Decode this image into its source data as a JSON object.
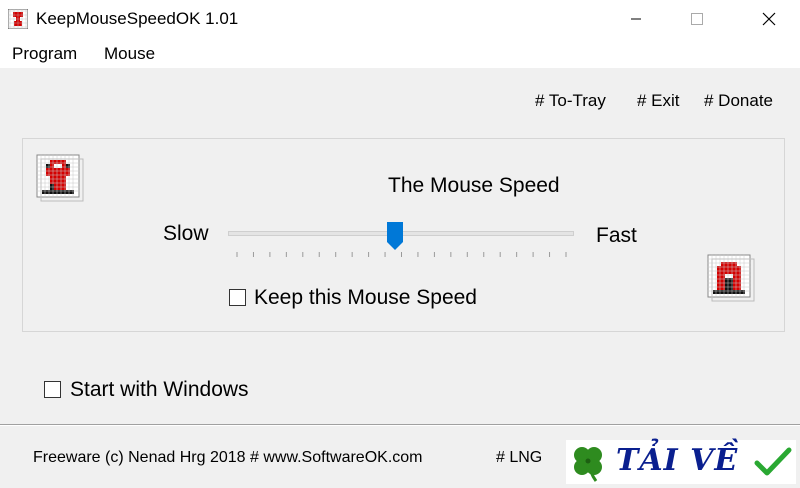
{
  "window": {
    "title": "KeepMouseSpeedOK 1.01",
    "icons": {
      "app": "app-grid-icon",
      "minimize": "minimize-icon",
      "maximize": "maximize-icon",
      "close": "close-icon"
    }
  },
  "menu": {
    "items": [
      "Program",
      "Mouse"
    ]
  },
  "links": {
    "to_tray": "# To-Tray",
    "exit": "# Exit",
    "donate": "# Donate"
  },
  "main": {
    "speed_title": "The Mouse Speed",
    "slow_label": "Slow",
    "fast_label": "Fast",
    "slider_value_fraction": 0.48,
    "keep_speed_label": "Keep this Mouse Speed",
    "keep_speed_checked": false,
    "left_icon": "mouse-grid-icon",
    "right_icon": "house-grid-icon"
  },
  "options": {
    "start_with_windows_label": "Start with Windows",
    "start_with_windows_checked": false
  },
  "footer": {
    "credit": "Freeware (c) Nenad Hrg 2018 # www.SoftwareOK.com",
    "lng": "# LNG",
    "banner_text": "TẢI VỀ",
    "banner_icons": [
      "clover-icon",
      "checkmark-icon"
    ]
  },
  "colors": {
    "accent": "#0078d7",
    "banner_text": "#0a1f8f",
    "clover": "#2e8b1f",
    "checkmark": "#2aa832",
    "icon_red": "#d40000"
  }
}
